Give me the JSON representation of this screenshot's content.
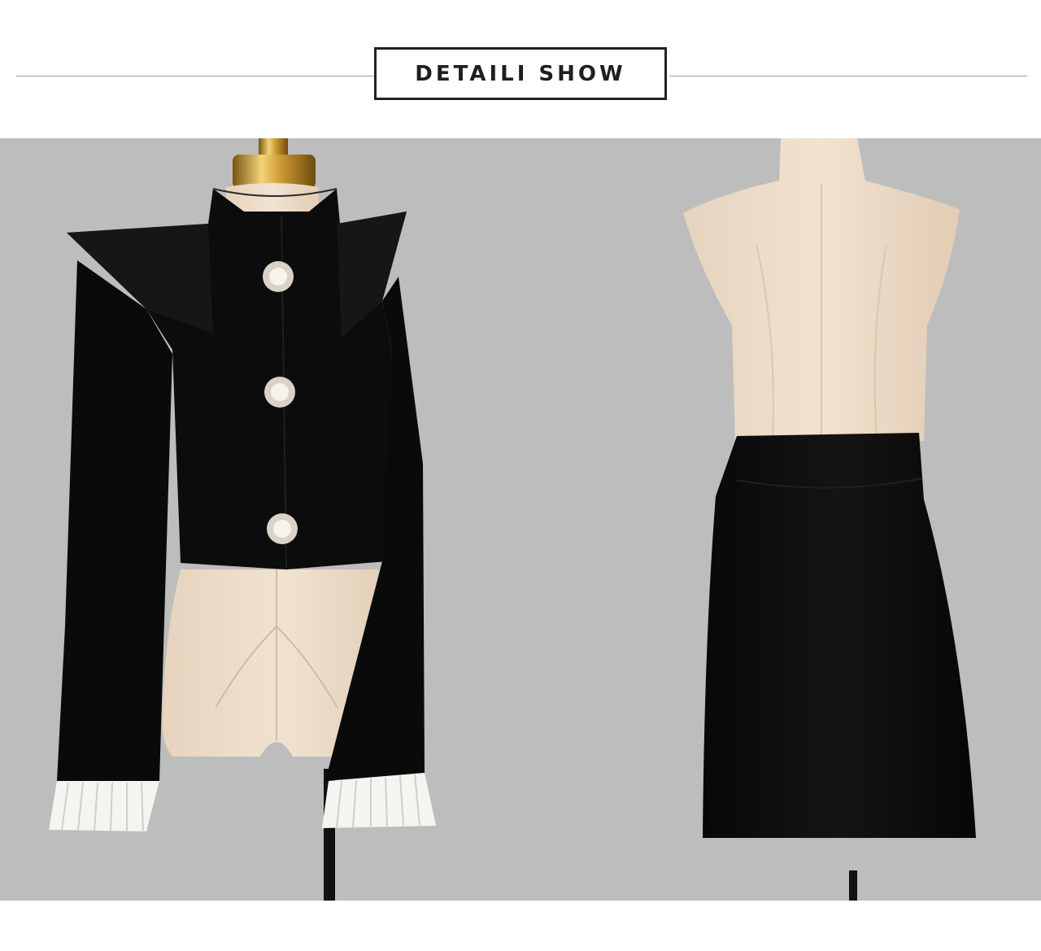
{
  "header": {
    "title": "DETAILI SHOW"
  },
  "photo": {
    "subjects": [
      "cropped-jacket-on-mannequin",
      "skirt-on-mannequin"
    ],
    "colors": {
      "background": "#bdbdbd",
      "garment": "#0c0c0c",
      "mannequin": "#ecdcc9",
      "cuff": "#f4f4f0",
      "gold": "#d4a23a"
    }
  }
}
